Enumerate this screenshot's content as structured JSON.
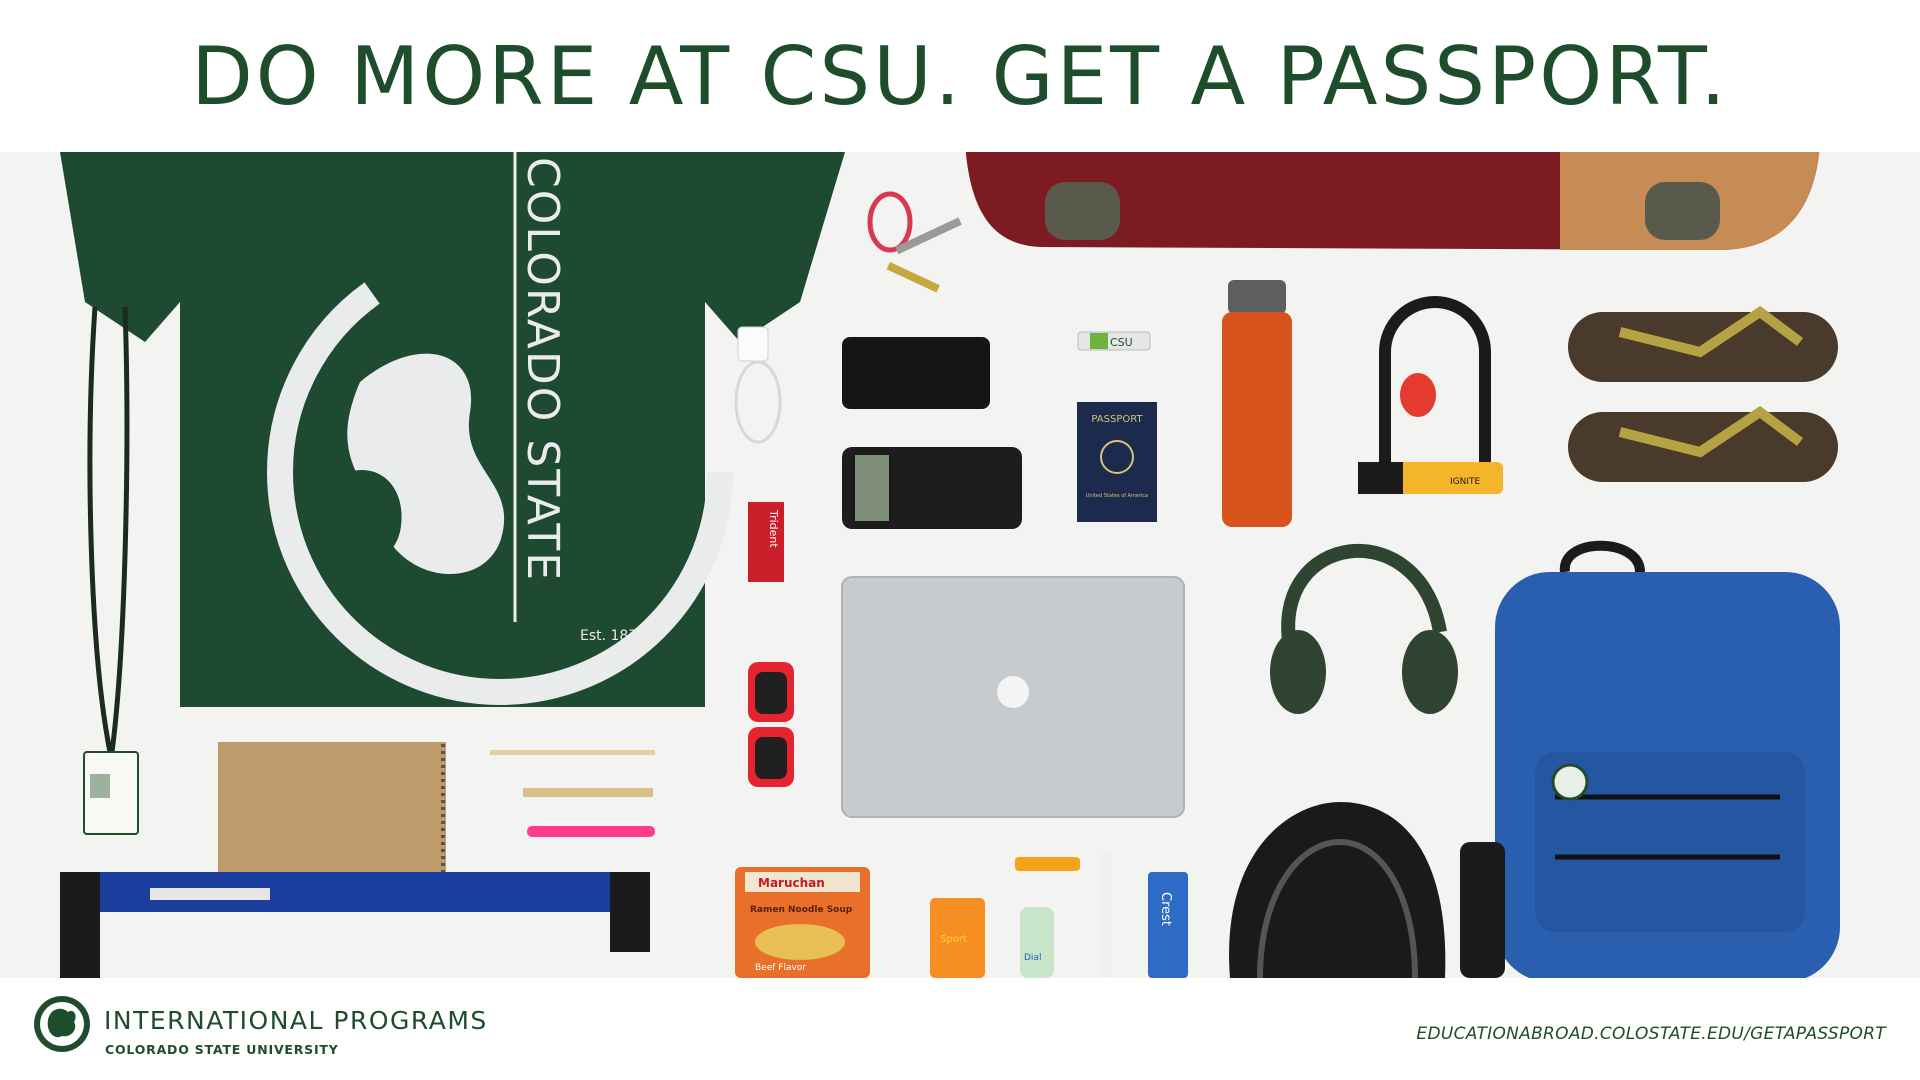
{
  "headline": "DO MORE AT CSU. GET A PASSPORT.",
  "photo": {
    "shirt_text": "COLORADO STATE",
    "shirt_est": "Est. 1870",
    "usb_label": "CSU",
    "passport_title": "PASSPORT",
    "passport_country": "United States of America",
    "noodle_brand": "Maruchan",
    "noodle_name": "Ramen Noodle Soup",
    "noodle_flavor": "Beef Flavor",
    "gum_brand": "Trident",
    "sunscreen_brand": "Sport",
    "soap_brand": "Dial",
    "toothpaste_brand": "Crest",
    "lock_label": "IGNITE"
  },
  "footer": {
    "program": "INTERNATIONAL PROGRAMS",
    "university": "COLORADO STATE UNIVERSITY",
    "url": "EDUCATIONABROAD.COLOSTATE.EDU/GETAPASSPORT"
  },
  "colors": {
    "csu_green": "#1e4d2b",
    "shirt_green": "#1f4a32",
    "backpack_blue": "#2a5fb0",
    "bottle_orange": "#d8541f"
  }
}
